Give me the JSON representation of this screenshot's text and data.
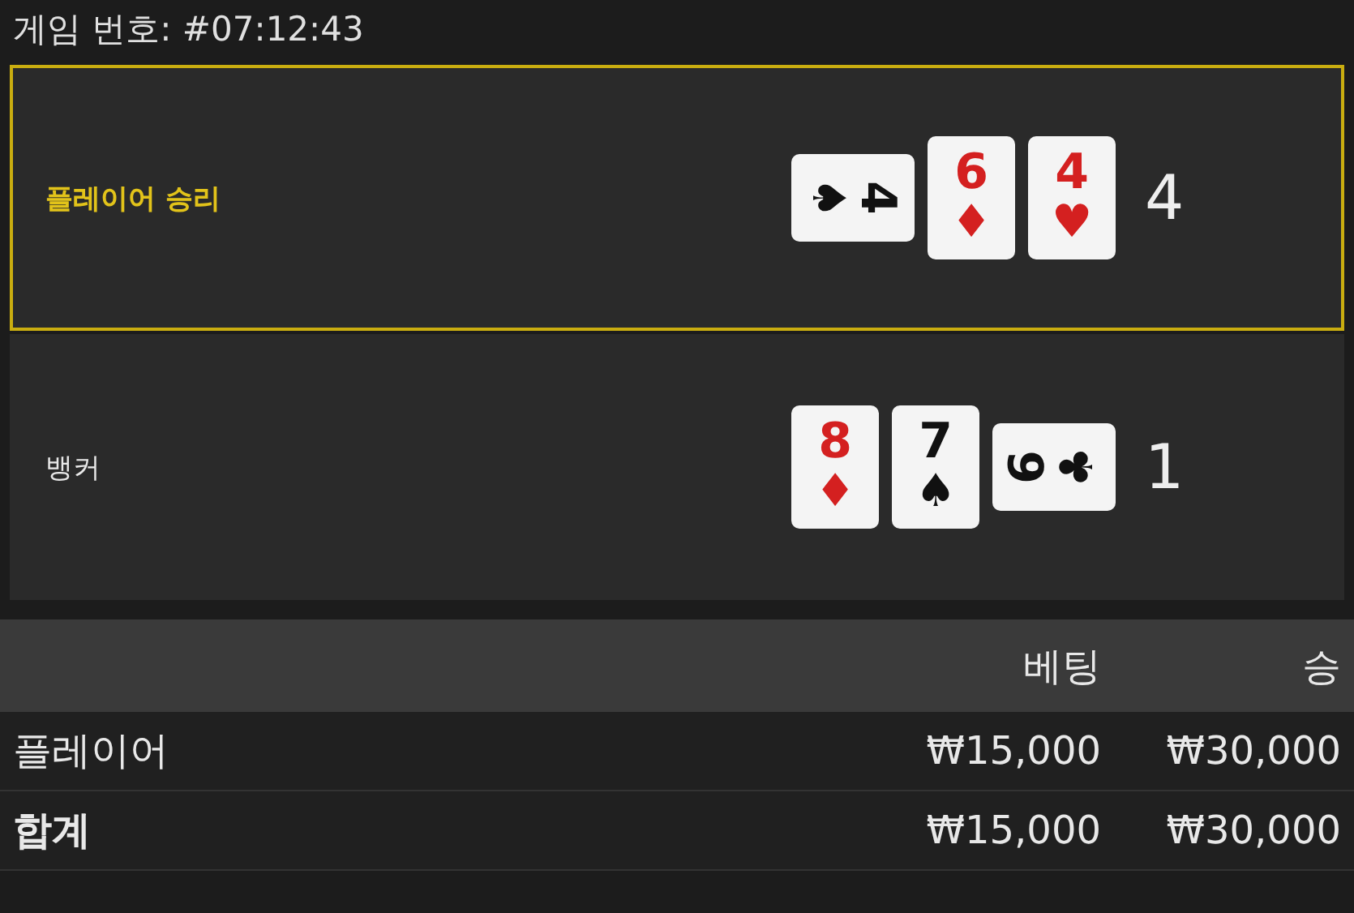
{
  "game_number": "게임 번호: #07:12:43",
  "hands": [
    {
      "label": "플레이어 승리",
      "winner": true,
      "total": "4",
      "cards": [
        {
          "rank": "4",
          "suit": "♠",
          "kind": "sideways"
        },
        {
          "rank": "6",
          "suit": "♦",
          "kind": "upright"
        },
        {
          "rank": "4",
          "suit": "♥",
          "kind": "upright"
        }
      ]
    },
    {
      "label": "뱅커",
      "winner": false,
      "total": "1",
      "cards": [
        {
          "rank": "8",
          "suit": "♦",
          "kind": "upright"
        },
        {
          "rank": "7",
          "suit": "♠",
          "kind": "upright"
        },
        {
          "rank": "6",
          "suit": "♣",
          "kind": "sideways"
        }
      ]
    }
  ],
  "table": {
    "columns": [
      "",
      "베팅",
      "승"
    ],
    "rows": [
      {
        "kind": "normal",
        "cells": [
          "플레이어",
          "₩15,000",
          "₩30,000"
        ]
      },
      {
        "kind": "total",
        "cells": [
          "합계",
          "₩15,000",
          "₩30,000"
        ]
      }
    ]
  }
}
